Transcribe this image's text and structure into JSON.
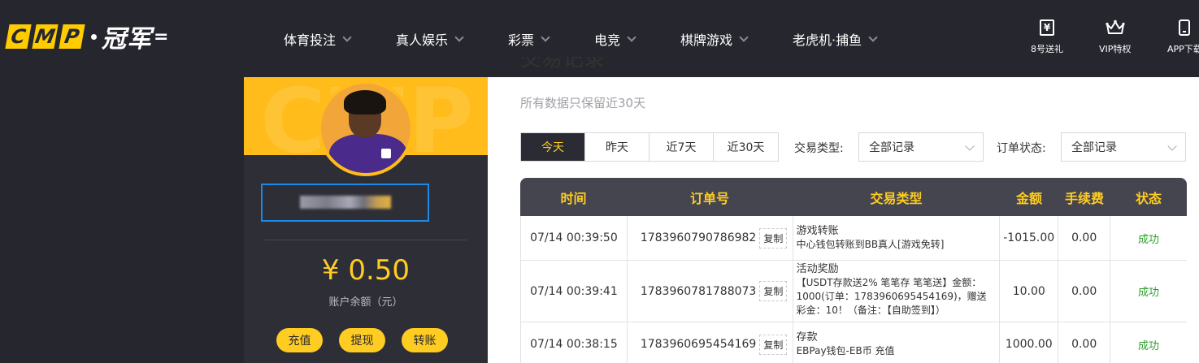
{
  "header": {
    "logo_text": "CMP",
    "logo_cn": "冠军",
    "nav": [
      {
        "label": "体育投注"
      },
      {
        "label": "真人娱乐"
      },
      {
        "label": "彩票"
      },
      {
        "label": "电竞"
      },
      {
        "label": "棋牌游戏"
      },
      {
        "label": "老虎机·捕鱼"
      }
    ],
    "right": [
      {
        "label": "8号送礼",
        "icon": "gift-icon"
      },
      {
        "label": "VIP特权",
        "icon": "crown-icon"
      },
      {
        "label": "APP下载",
        "icon": "phone-icon"
      }
    ]
  },
  "profile": {
    "balance": "¥ 0.50",
    "balance_label": "账户余额（元）",
    "buttons": [
      "充值",
      "提现",
      "转账"
    ]
  },
  "main": {
    "title": "交易记录",
    "subtitle": "所有数据只保留近30天",
    "tabs": [
      "今天",
      "昨天",
      "近7天",
      "近30天"
    ],
    "active_tab": 0,
    "filter_type_label": "交易类型:",
    "filter_type_value": "全部记录",
    "filter_status_label": "订单状态:",
    "filter_status_value": "全部记录"
  },
  "table": {
    "headers": [
      "时间",
      "订单号",
      "交易类型",
      "金额",
      "手续费",
      "状态"
    ],
    "copy_label": "复制",
    "rows": [
      {
        "time": "07/14 00:39:50",
        "order": "1783960790786982",
        "type_title": "游戏转账",
        "type_detail": "中心钱包转账到BB真人[游戏免转]",
        "amount": "-1015.00",
        "fee": "0.00",
        "status": "成功"
      },
      {
        "time": "07/14 00:39:41",
        "order": "1783960781788073",
        "type_title": "活动奖励",
        "type_detail": "【USDT存款送2% 笔笔存 笔笔送】金额：1000(订单：1783960695454169)，赠送彩金：10！（备注：【自助签到】）",
        "amount": "10.00",
        "fee": "0.00",
        "status": "成功"
      },
      {
        "time": "07/14 00:38:15",
        "order": "1783960695454169",
        "type_title": "存款",
        "type_detail": "EBPay钱包-EB币 充值",
        "amount": "1000.00",
        "fee": "0.00",
        "status": "成功"
      }
    ]
  }
}
